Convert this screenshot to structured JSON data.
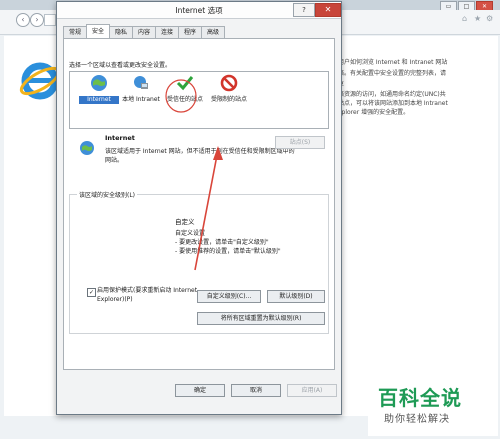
{
  "dialog": {
    "title": "Internet 选项",
    "help_label": "?",
    "close_label": "✕"
  },
  "tabs": [
    {
      "label": "常规",
      "active": false
    },
    {
      "label": "安全",
      "active": true
    },
    {
      "label": "隐私",
      "active": false
    },
    {
      "label": "内容",
      "active": false
    },
    {
      "label": "连接",
      "active": false
    },
    {
      "label": "程序",
      "active": false
    },
    {
      "label": "高级",
      "active": false
    }
  ],
  "security": {
    "hint": "选择一个区域以查看或更改安全设置。",
    "zones": [
      {
        "label": "Internet",
        "icon": "globe-icon",
        "selected": true
      },
      {
        "label": "本地 Intranet",
        "icon": "intranet-icon",
        "selected": false
      },
      {
        "label": "受信任的站点",
        "icon": "checkmark-icon",
        "selected": false
      },
      {
        "label": "受限制的站点",
        "icon": "restricted-icon",
        "selected": false
      }
    ],
    "zone_title": "Internet",
    "zone_description": "该区域适用于 Internet 网站，但不适用于列在受信任和受限制区域中的网站。",
    "sites_button": "站点(S)",
    "level_caption": "该区域的安全级别(L)",
    "custom_title": "自定义",
    "custom_lines": [
      "自定义设置",
      "- 要更改设置，请单击\"自定义级别\"",
      "- 要使用推荐的设置，请单击\"默认级别\""
    ],
    "protected_mode_checked": true,
    "protected_mode_label": "启用保护模式(要求重新启动 Internet Explorer)(P)",
    "custom_level_button": "自定义级别(C)...",
    "default_level_button": "默认级别(D)",
    "reset_all_button": "将所有区域重置为默认级别(R)"
  },
  "footer": {
    "ok": "确定",
    "cancel": "取消",
    "apply": "应用(A)"
  },
  "background": {
    "window_minimize": "▭",
    "window_maximize": "□",
    "window_close": "✕",
    "text_lines": [
      "用户如何浏览 Internet 和 Intranet 网站",
      "络。有关配置中安全设置的完整列表，请",
      "享"
    ],
    "lower_lines": [
      "络资源的访问，如通用命名约定(UNC)共",
      "站点，可以将该网站添加到本地 Intranet"
    ],
    "link_line": "xplorer 增强的安全配置。"
  },
  "watermark": {
    "title": "百科全说",
    "subtitle": "助你轻松解决"
  },
  "colors": {
    "accent_selection": "#3476c8",
    "arrow": "#d9453a",
    "watermark_green": "#1e9a55"
  }
}
